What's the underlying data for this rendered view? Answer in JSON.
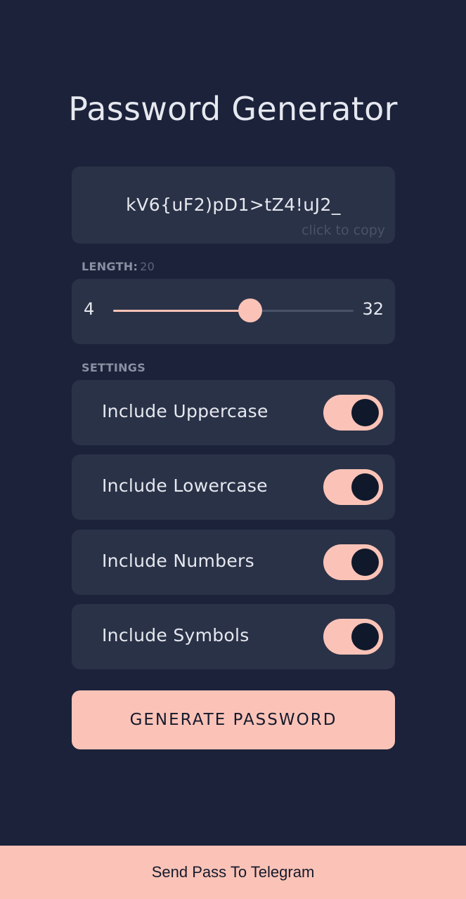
{
  "title": "Password Generator",
  "password": {
    "value": "kV6{uF2)pD1>tZ4!uJ2_",
    "hint": "click to copy"
  },
  "length": {
    "label": "LENGTH:",
    "value": "20",
    "min": "4",
    "max": "32",
    "slider_fraction": 0.57
  },
  "settings": {
    "label": "SETTINGS",
    "items": [
      {
        "label": "Include Uppercase",
        "enabled": true
      },
      {
        "label": "Include Lowercase",
        "enabled": true
      },
      {
        "label": "Include Numbers",
        "enabled": true
      },
      {
        "label": "Include Symbols",
        "enabled": true
      }
    ]
  },
  "generate_button": "GENERATE PASSWORD",
  "telegram_button": "Send Pass To Telegram",
  "colors": {
    "background": "#1b223a",
    "card": "#2a3247",
    "accent": "#fbc3b7",
    "knob": "#10192b"
  }
}
